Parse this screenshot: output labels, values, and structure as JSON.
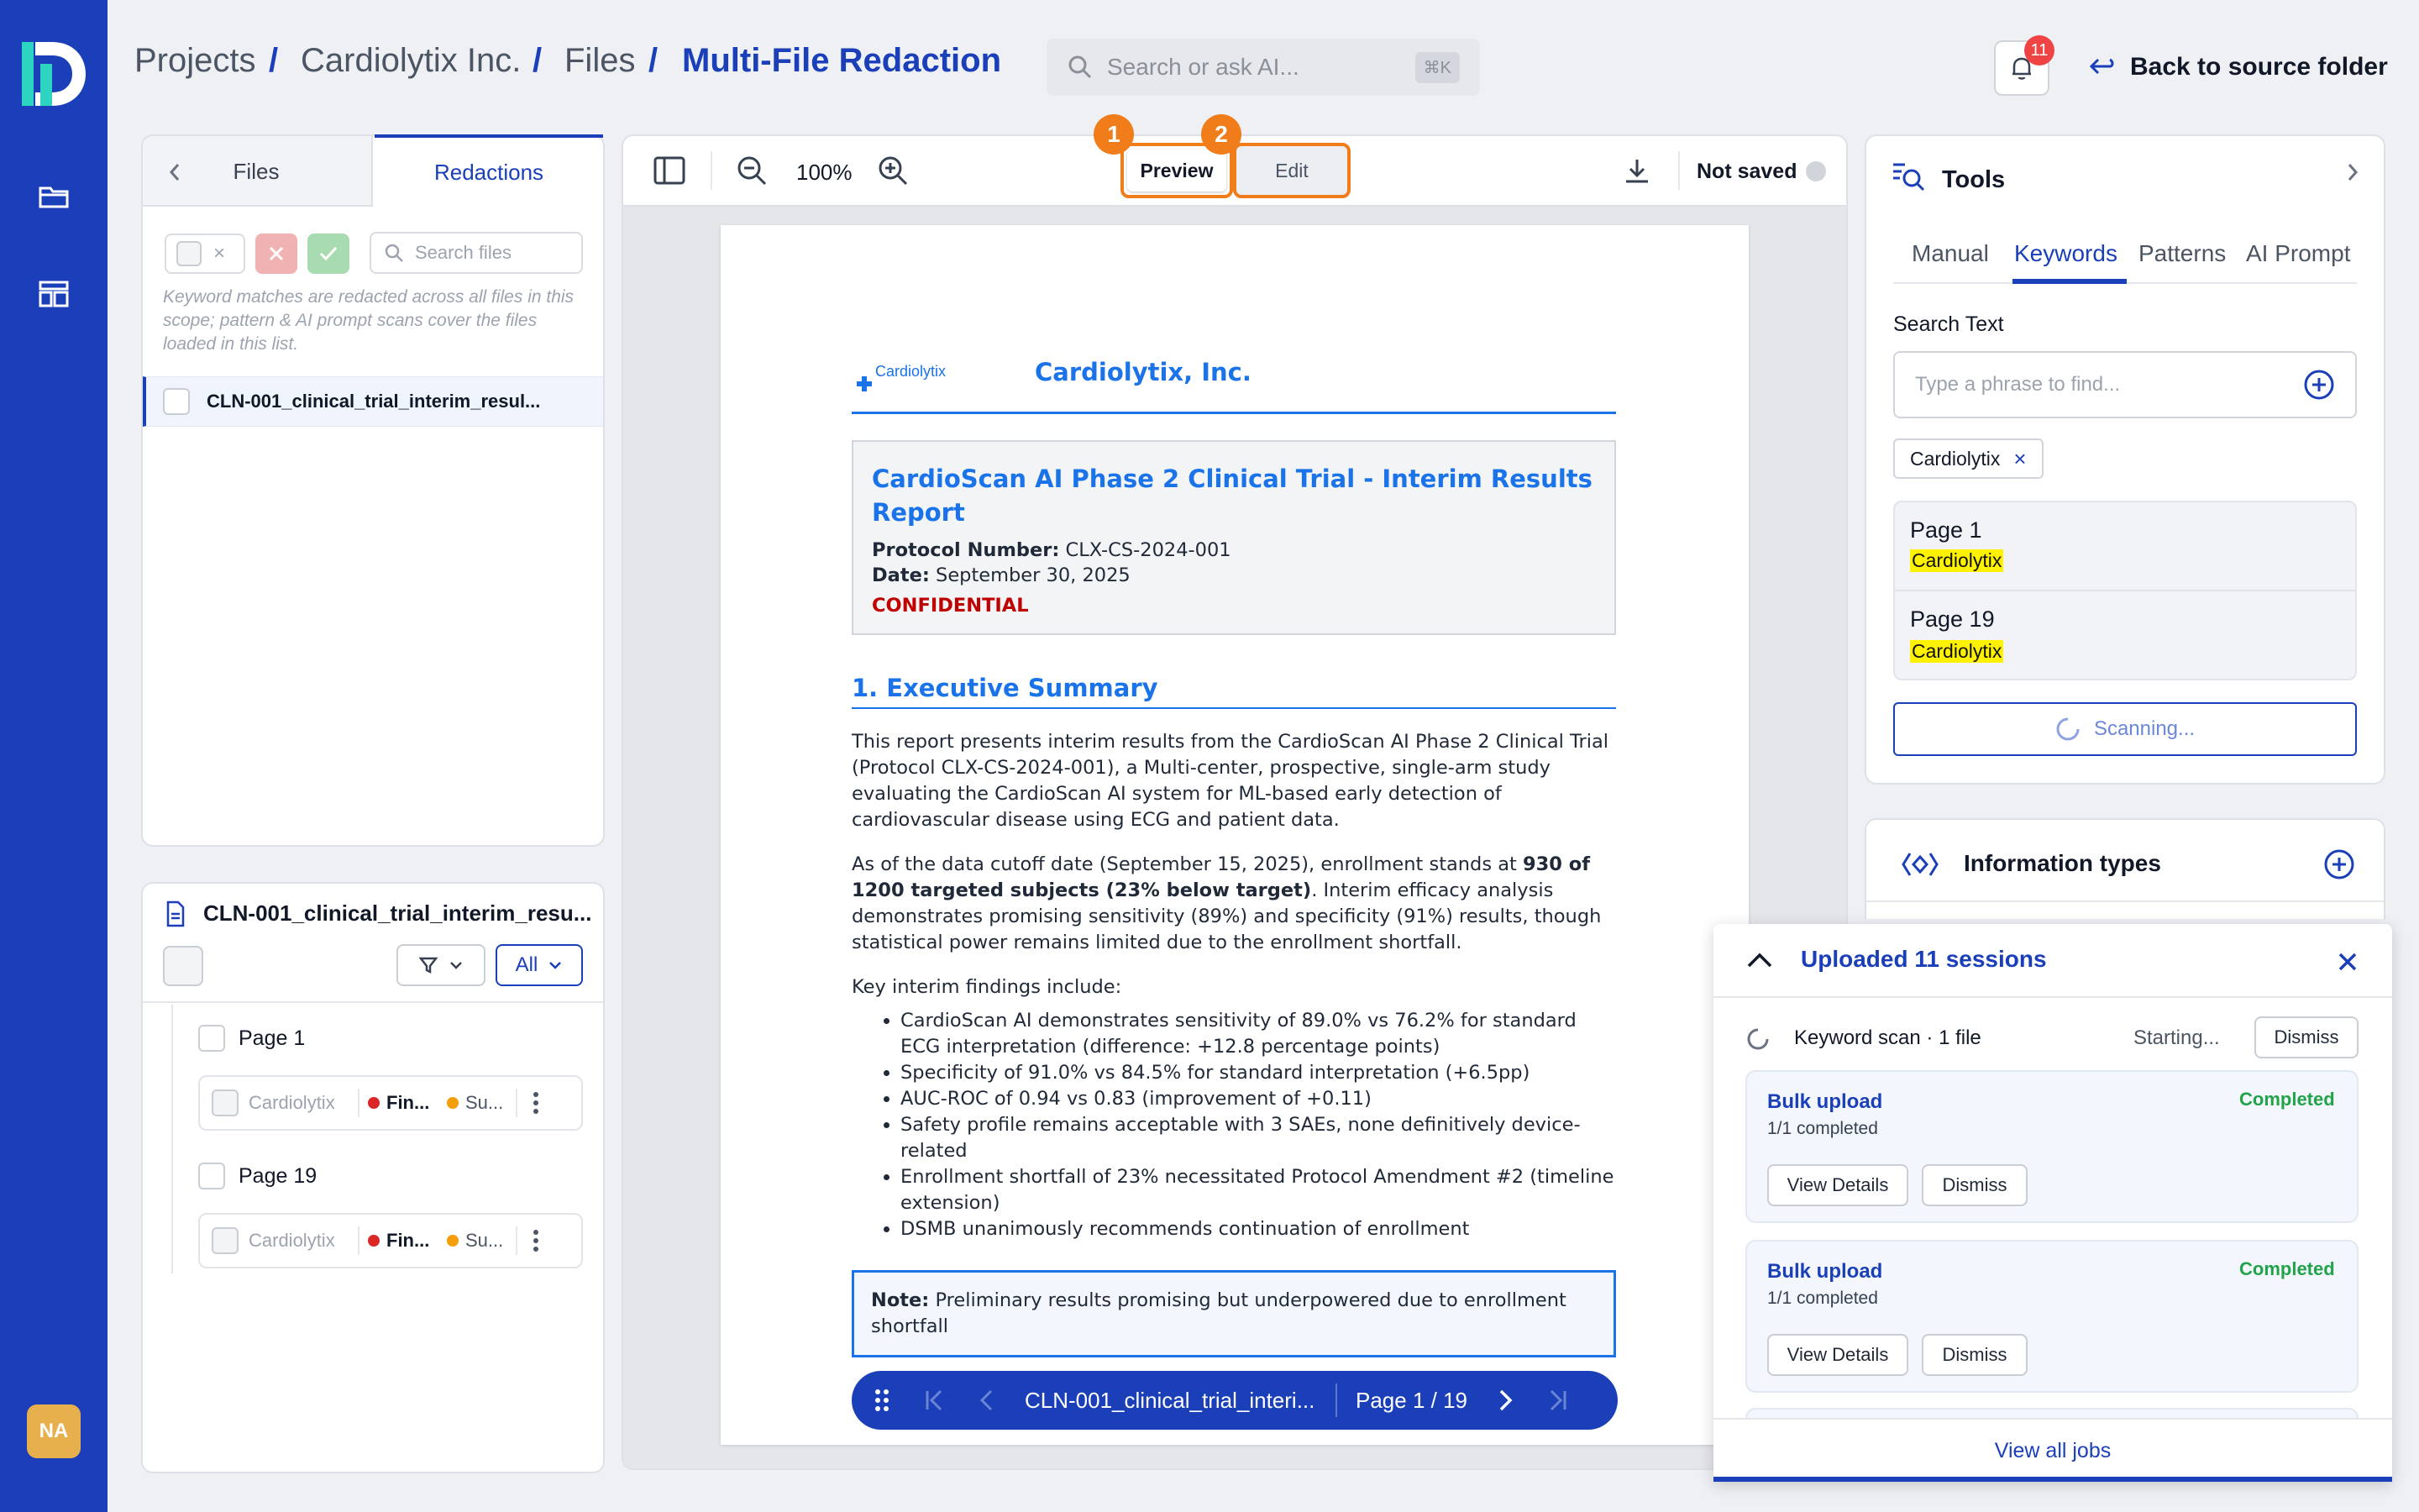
{
  "breadcrumb": {
    "items": [
      "Projects",
      "Cardiolytix Inc.",
      "Files"
    ],
    "current": "Multi-File Redaction",
    "separator": "/"
  },
  "search": {
    "placeholder": "Search or ask AI...",
    "shortcut": "⌘K"
  },
  "notifications": {
    "count": "11"
  },
  "back_label": "Back to source folder",
  "user": {
    "initials": "NA"
  },
  "left_panel": {
    "tabs": [
      "Files",
      "Redactions"
    ],
    "active_tab": "Redactions",
    "search_placeholder": "Search files",
    "help_text": "Keyword matches are redacted across all files in this scope; pattern & AI prompt scans cover the files loaded in this list.",
    "files": [
      "CLN-001_clinical_trial_interim_resul..."
    ]
  },
  "file_detail": {
    "name": "CLN-001_clinical_trial_interim_resu...",
    "filter_label": "All",
    "pages": [
      {
        "label": "Page 1",
        "term": "Cardiolytix",
        "type": "Fin...",
        "status": "Su..."
      },
      {
        "label": "Page 19",
        "term": "Cardiolytix",
        "type": "Fin...",
        "status": "Su..."
      }
    ]
  },
  "viewer": {
    "zoom": "100%",
    "preview_label": "Preview",
    "edit_label": "Edit",
    "callouts": [
      "1",
      "2"
    ],
    "save_status": "Not saved"
  },
  "document": {
    "logo_text": "Cardiolytix",
    "company": "Cardiolytix, Inc.",
    "report_title": "CardioScan AI Phase 2 Clinical Trial - Interim Results Report",
    "protocol_label": "Protocol Number:",
    "protocol_value": "CLX-CS-2024-001",
    "date_label": "Date:",
    "date_value": "September 30, 2025",
    "confidential": "CONFIDENTIAL",
    "section_title": "1. Executive Summary",
    "para1": "This report presents interim results from the CardioScan AI Phase 2 Clinical Trial (Protocol CLX-CS-2024-001), a Multi-center, prospective, single-arm study evaluating the CardioScan AI system for ML-based early detection of cardiovascular disease using ECG and patient data.",
    "para2_a": "As of the data cutoff date (September 15, 2025), enrollment stands at ",
    "para2_b": "930 of 1200 targeted subjects (23% below target)",
    "para2_c": ". Interim efficacy analysis demonstrates promising sensitivity (89%) and specificity (91%) results, though statistical power remains limited due to the enrollment shortfall.",
    "findings_intro": "Key interim findings include:",
    "findings": [
      "CardioScan AI demonstrates sensitivity of 89.0% vs 76.2% for standard ECG interpretation (difference: +12.8 percentage points)",
      "Specificity of 91.0% vs 84.5% for standard interpretation (+6.5pp)",
      "AUC-ROC of 0.94 vs 0.83 (improvement of +0.11)",
      "Safety profile remains acceptable with 3 SAEs, none definitively device-related",
      "Enrollment shortfall of 23% necessitated Protocol Amendment #2 (timeline extension)",
      "DSMB unanimously recommends continuation of enrollment"
    ],
    "note_label": "Note:",
    "note_text": "Preliminary results promising but underpowered due to enrollment shortfall"
  },
  "page_nav": {
    "file": "CLN-001_clinical_trial_interi...",
    "page": "Page 1 / 19"
  },
  "tools": {
    "title": "Tools",
    "tabs": [
      "Manual",
      "Keywords",
      "Patterns",
      "AI Prompt"
    ],
    "active_tab": "Keywords",
    "search_label": "Search Text",
    "search_placeholder": "Type a phrase to find...",
    "chip": "Cardiolytix",
    "results": [
      {
        "page": "Page 1",
        "match": "Cardiolytix"
      },
      {
        "page": "Page 19",
        "match": "Cardiolytix"
      }
    ],
    "scanning_label": "Scanning..."
  },
  "info_types": {
    "title": "Information types"
  },
  "jobs": {
    "title": "Uploaded 11 sessions",
    "scan": {
      "label": "Keyword scan · 1 file",
      "status": "Starting...",
      "dismiss": "Dismiss"
    },
    "cards": [
      {
        "title": "Bulk upload",
        "progress": "1/1 completed",
        "status": "Completed",
        "details": "View Details",
        "dismiss": "Dismiss"
      },
      {
        "title": "Bulk upload",
        "progress": "1/1 completed",
        "status": "Completed",
        "details": "View Details",
        "dismiss": "Dismiss"
      }
    ],
    "view_all": "View all jobs"
  },
  "colors": {
    "brand": "#1a3fb8",
    "doc_accent": "#1a73e8",
    "callout": "#f07d1a",
    "success": "#22a34a",
    "danger": "#dc2626"
  }
}
